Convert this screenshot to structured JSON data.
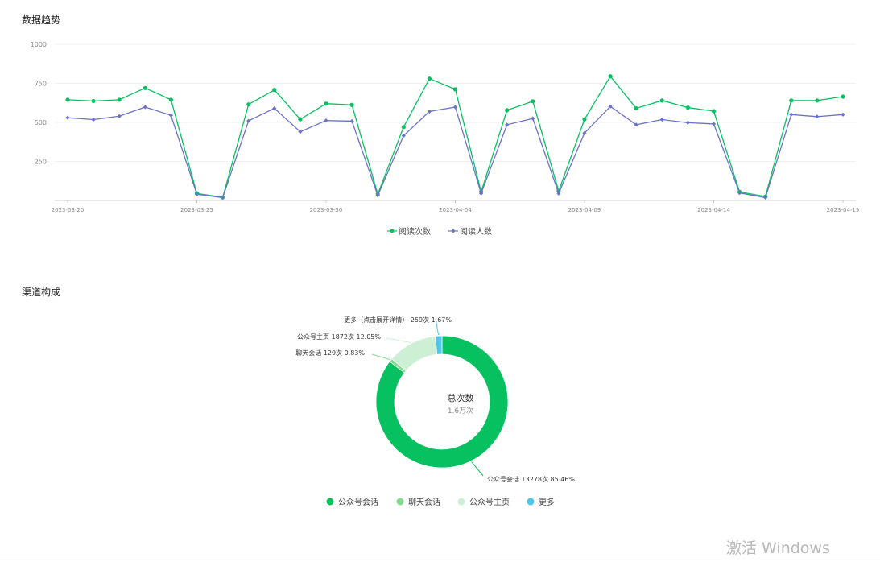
{
  "sections": {
    "trend_title": "数据趋势",
    "channel_title": "渠道构成"
  },
  "watermark": "激活 Windows",
  "colors": {
    "reads": "#07c160",
    "readers": "#6b73c9",
    "pie_official_session": "#07c160",
    "pie_chat_session": "#87d98e",
    "pie_official_home": "#cdefd3",
    "pie_more": "#4cc6e8"
  },
  "chart_data": [
    {
      "type": "line",
      "title": "",
      "ylim": [
        0,
        1000
      ],
      "y_ticks": [
        "1000",
        "750",
        "500",
        "250"
      ],
      "x_tick_labels": [
        "2023-03-20",
        "2023-03-25",
        "2023-03-30",
        "2023-04-04",
        "2023-04-09",
        "2023-04-14",
        "2023-04-19"
      ],
      "x": [
        "2023-03-20",
        "2023-03-21",
        "2023-03-22",
        "2023-03-23",
        "2023-03-24",
        "2023-03-25",
        "2023-03-26",
        "2023-03-27",
        "2023-03-28",
        "2023-03-29",
        "2023-03-30",
        "2023-03-31",
        "2023-04-01",
        "2023-04-02",
        "2023-04-03",
        "2023-04-04",
        "2023-04-05",
        "2023-04-06",
        "2023-04-07",
        "2023-04-08",
        "2023-04-09",
        "2023-04-10",
        "2023-04-11",
        "2023-04-12",
        "2023-04-13",
        "2023-04-14",
        "2023-04-15",
        "2023-04-16",
        "2023-04-17",
        "2023-04-18",
        "2023-04-19"
      ],
      "grid": true,
      "legend_position": "bottom-center",
      "series": [
        {
          "name": "阅读次数",
          "values": [
            645,
            637,
            645,
            720,
            645,
            45,
            20,
            615,
            708,
            520,
            620,
            612,
            40,
            470,
            780,
            712,
            55,
            578,
            635,
            60,
            520,
            795,
            590,
            640,
            595,
            572,
            55,
            25,
            640,
            640,
            665
          ]
        },
        {
          "name": "阅读人数",
          "values": [
            530,
            518,
            540,
            598,
            545,
            40,
            18,
            510,
            590,
            440,
            512,
            508,
            32,
            415,
            570,
            598,
            45,
            485,
            525,
            45,
            432,
            602,
            485,
            518,
            498,
            490,
            48,
            18,
            550,
            537,
            550
          ]
        }
      ]
    },
    {
      "type": "pie",
      "donut": true,
      "center_title": "总次数",
      "center_value": "1.6万次",
      "legend_position": "bottom-center",
      "slices": [
        {
          "name": "公众号会话",
          "value": 13278,
          "count_text": "13278次",
          "percent_text": "85.46%"
        },
        {
          "name": "聊天会话",
          "value": 129,
          "count_text": "129次",
          "percent_text": "0.83%"
        },
        {
          "name": "公众号主页",
          "value": 1872,
          "count_text": "1872次",
          "percent_text": "12.05%"
        },
        {
          "name": "更多",
          "label_name": "更多（点击展开详情）",
          "value": 259,
          "count_text": "259次",
          "percent_text": "1.67%"
        }
      ]
    }
  ]
}
